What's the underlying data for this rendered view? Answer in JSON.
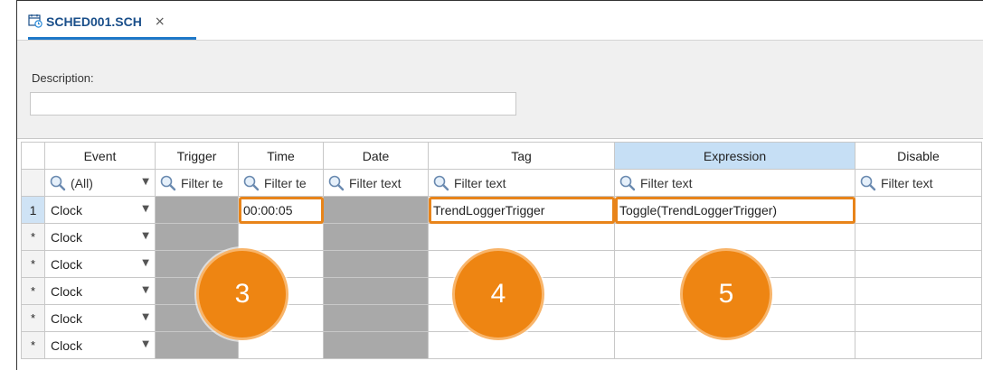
{
  "tab": {
    "title": "SCHED001.SCH",
    "close": "×"
  },
  "description": {
    "label": "Description:",
    "value": ""
  },
  "grid": {
    "columns": [
      "Event",
      "Trigger",
      "Time",
      "Date",
      "Tag",
      "Expression",
      "Disable"
    ],
    "filters": {
      "event": "(All)",
      "trigger": "Filter te",
      "time": "Filter te",
      "date": "Filter text",
      "tag": "Filter text",
      "expression": "Filter text",
      "disable": "Filter text"
    },
    "rows": [
      {
        "header": "1",
        "event": "Clock",
        "time": "00:00:05",
        "tag": "TrendLoggerTrigger",
        "expression": "Toggle(TrendLoggerTrigger)"
      },
      {
        "header": "*",
        "event": "Clock",
        "time": "",
        "tag": "",
        "expression": ""
      },
      {
        "header": "*",
        "event": "Clock",
        "time": "",
        "tag": "",
        "expression": ""
      },
      {
        "header": "*",
        "event": "Clock",
        "time": "",
        "tag": "",
        "expression": ""
      },
      {
        "header": "*",
        "event": "Clock",
        "time": "",
        "tag": "",
        "expression": ""
      },
      {
        "header": "*",
        "event": "Clock",
        "time": "",
        "tag": "",
        "expression": ""
      }
    ]
  },
  "callouts": [
    "3",
    "4",
    "5"
  ],
  "colors": {
    "accent": "#1e78c8",
    "callout": "#ee8512",
    "highlight": "#e8841a",
    "selected_header": "#c6dff5"
  }
}
